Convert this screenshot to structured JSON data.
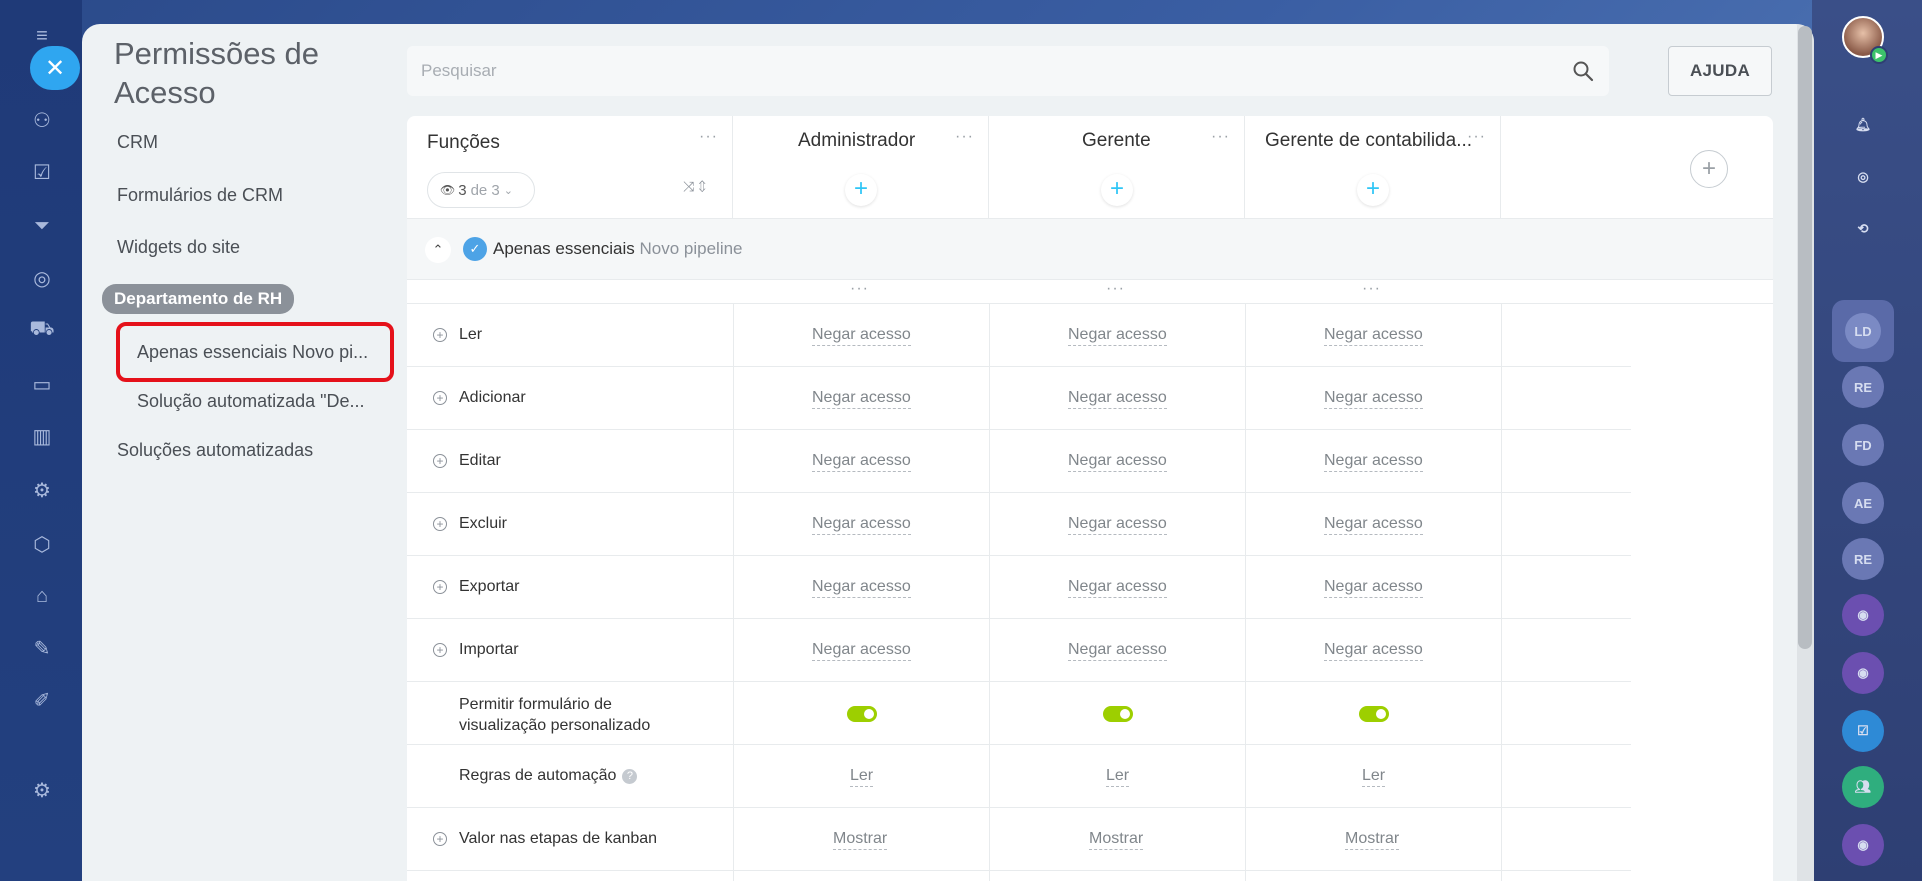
{
  "page": {
    "title_line1": "Permissões de",
    "title_line2": "Acesso"
  },
  "search": {
    "placeholder": "Pesquisar"
  },
  "help_label": "AJUDA",
  "menu": {
    "items": [
      "CRM",
      "Formulários de CRM",
      "Widgets do site"
    ],
    "group": "Departamento de RH",
    "sub_items": [
      "Apenas essenciais Novo pi...",
      "Solução automatizada \"De..."
    ],
    "last": "Soluções automatizadas"
  },
  "table": {
    "functions_label": "Funções",
    "filter": {
      "count": "3",
      "of": "de 3"
    },
    "columns": [
      "Administrador",
      "Gerente",
      "Gerente de contabilida..."
    ],
    "section": {
      "name": "Apenas essenciais",
      "sub": "Novo pipeline"
    },
    "rows": [
      {
        "label": "Ler",
        "expand": true,
        "values": [
          "Negar acesso",
          "Negar acesso",
          "Negar acesso"
        ]
      },
      {
        "label": "Adicionar",
        "expand": true,
        "values": [
          "Negar acesso",
          "Negar acesso",
          "Negar acesso"
        ]
      },
      {
        "label": "Editar",
        "expand": true,
        "values": [
          "Negar acesso",
          "Negar acesso",
          "Negar acesso"
        ]
      },
      {
        "label": "Excluir",
        "expand": true,
        "values": [
          "Negar acesso",
          "Negar acesso",
          "Negar acesso"
        ]
      },
      {
        "label": "Exportar",
        "expand": true,
        "values": [
          "Negar acesso",
          "Negar acesso",
          "Negar acesso"
        ]
      },
      {
        "label": "Importar",
        "expand": true,
        "values": [
          "Negar acesso",
          "Negar acesso",
          "Negar acesso"
        ]
      }
    ],
    "toggle_row": {
      "line1": "Permitir formulário de",
      "line2": "visualização personalizado"
    },
    "automation_row": {
      "label": "Regras de automação",
      "values": [
        "Ler",
        "Ler",
        "Ler"
      ]
    },
    "kanban_row": {
      "label": "Valor nas etapas de kanban",
      "values": [
        "Mostrar",
        "Mostrar",
        "Mostrar"
      ]
    }
  },
  "right_rail": {
    "initials": [
      "LD",
      "RE",
      "FD",
      "AE",
      "RE"
    ]
  },
  "colors": {
    "accent": "#2fc6f6",
    "toggle_on": "#9dcf00",
    "highlight": "#e5111a"
  }
}
